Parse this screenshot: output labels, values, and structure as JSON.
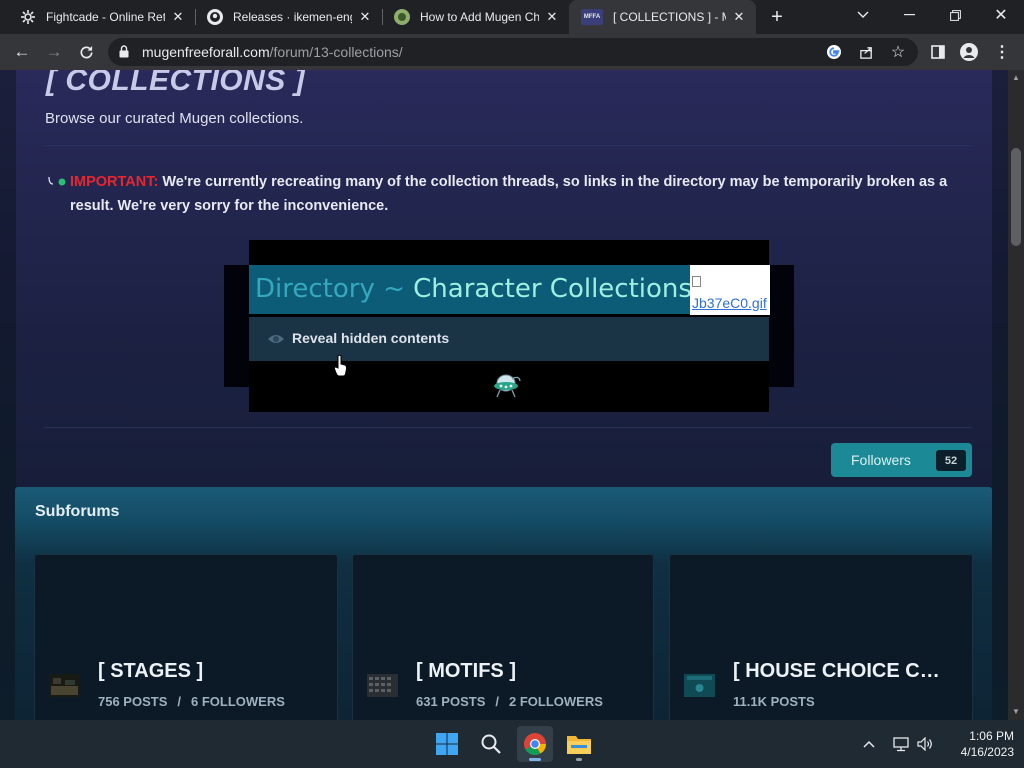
{
  "browser": {
    "tabs": [
      {
        "title": "Fightcade - Online Retro",
        "favicon": "fightcade-icon",
        "active": false
      },
      {
        "title": "Releases · ikemen-engine",
        "favicon": "github-icon",
        "active": false
      },
      {
        "title": "How to Add Mugen Ch",
        "favicon": "site-icon",
        "active": false
      },
      {
        "title": "[ COLLECTIONS ] - Mug",
        "favicon": "mffa-icon",
        "active": true
      }
    ],
    "favicon_mffa_text": "MFFA",
    "address": {
      "domain": "mugenfreeforall.com",
      "path": "/forum/13-collections/"
    }
  },
  "page": {
    "title": "[ COLLECTIONS ]",
    "description": "Browse our curated Mugen collections.",
    "notice": {
      "important_label": "IMPORTANT:",
      "text": "We're currently recreating many of the collection threads, so links in the directory may be temporarily broken as a result. We're very sorry for the inconvenience."
    },
    "directory": {
      "banner_prefix": "Directory ~ ",
      "banner_title": "Character Collections",
      "image_alt": "Jb37eC0.gif",
      "reveal_label": "Reveal hidden contents"
    },
    "followers": {
      "label": "Followers",
      "count": "52"
    },
    "subforums": {
      "title": "Subforums",
      "items": [
        {
          "name": "[ STAGES ]",
          "posts": "756 POSTS",
          "followers": "6 FOLLOWERS"
        },
        {
          "name": "[ MOTIFS ]",
          "posts": "631 POSTS",
          "followers": "2 FOLLOWERS"
        },
        {
          "name": "[ HOUSE CHOICE COLLECTIONS ]",
          "posts": "11.1K POSTS",
          "followers": ""
        }
      ]
    }
  },
  "taskbar": {
    "time": "1:06 PM",
    "date": "4/16/2023"
  },
  "colors": {
    "accent": "#1b8a96",
    "important": "#e8262e",
    "banner_bg": "#0c5c78"
  }
}
